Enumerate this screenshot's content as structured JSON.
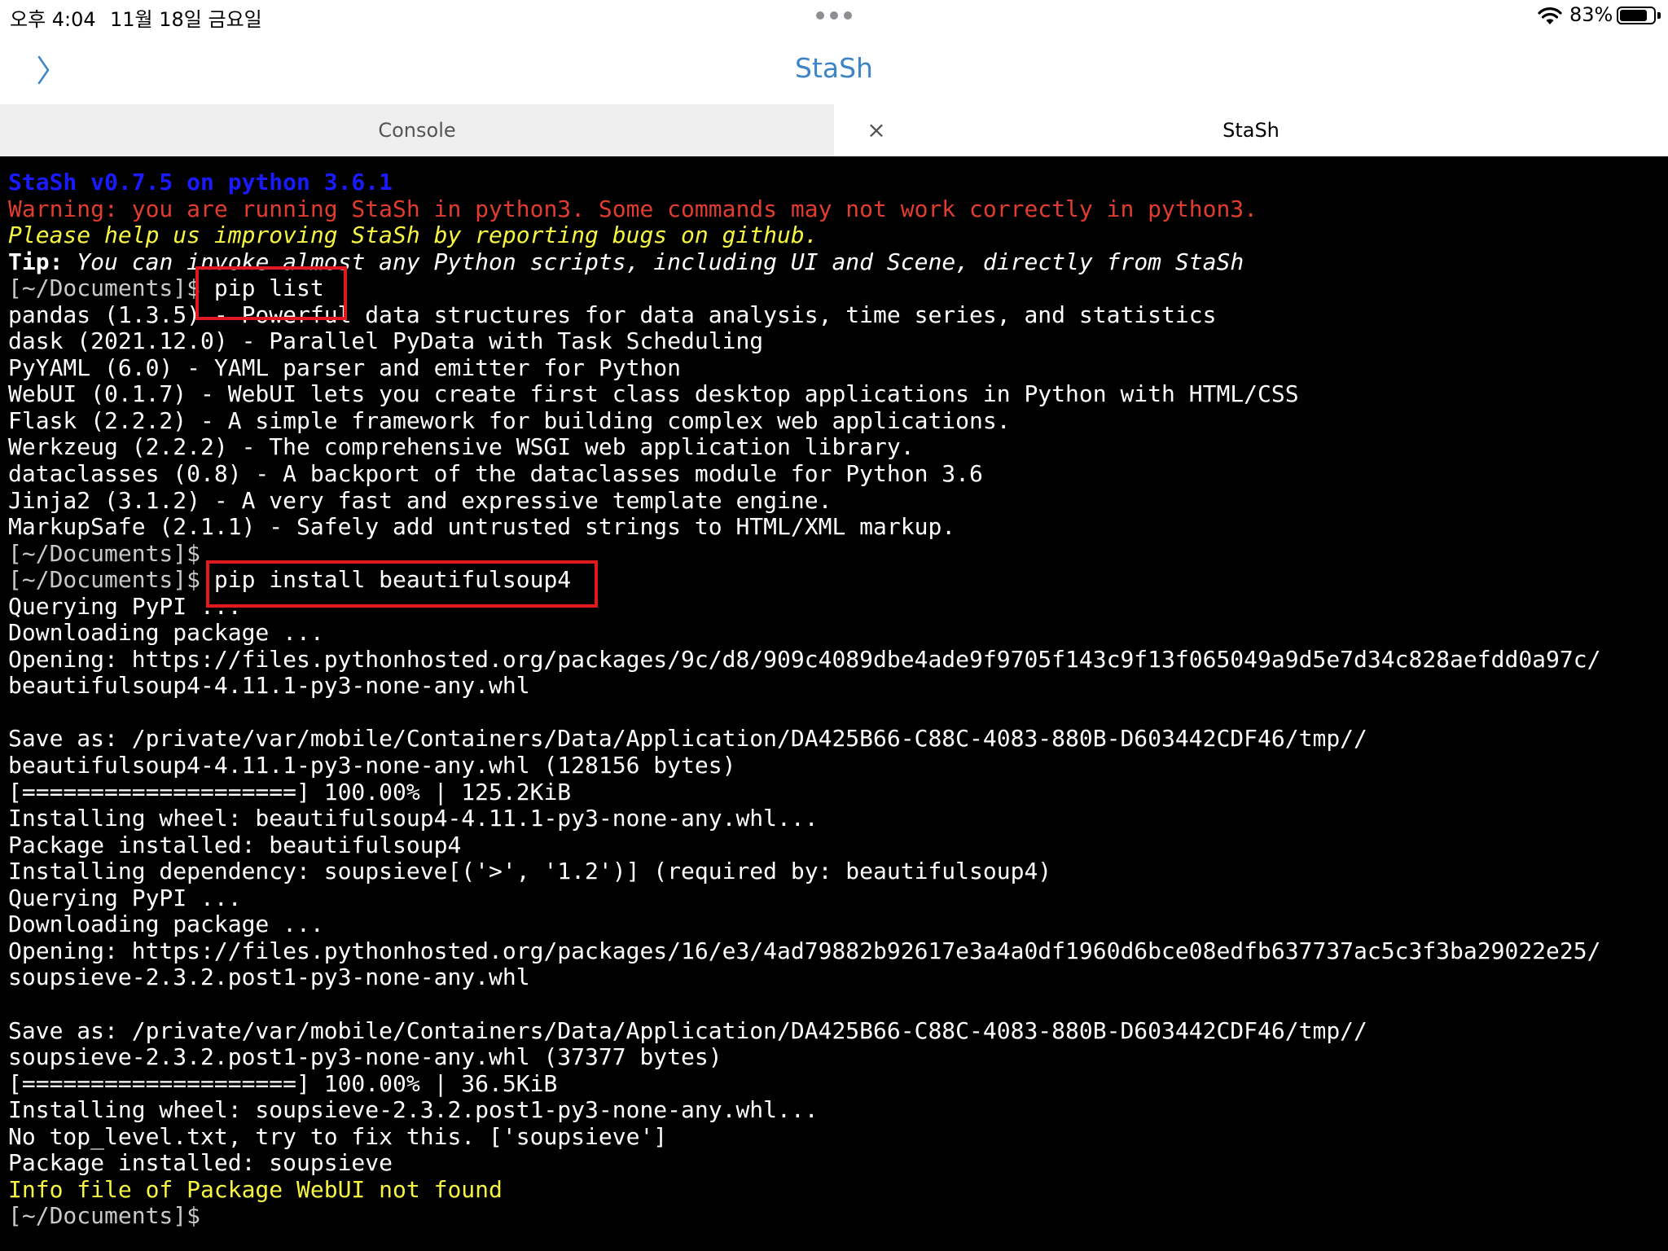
{
  "status": {
    "time": "오후 4:04",
    "date": "11월 18일 금요일",
    "battery": "83%",
    "battery_level": 0.83
  },
  "nav": {
    "title": "StaSh"
  },
  "tabs": [
    {
      "label": "Console"
    },
    {
      "label": "StaSh",
      "close": "×"
    }
  ],
  "terminal": {
    "header": "StaSh v0.7.5 on python 3.6.1",
    "warning": "Warning: you are running StaSh in python3. Some commands may not work correctly in python3.",
    "please": "Please help us improving StaSh by reporting bugs on github.",
    "tip_label": "Tip:",
    "tip_text": " You can invoke almost any Python scripts, including UI and Scene, directly from StaSh",
    "prompt": "[~/Documents]$",
    "cmd1": " pip list",
    "pip_list": [
      "pandas (1.3.5) - Powerful data structures for data analysis, time series, and statistics",
      "dask (2021.12.0) - Parallel PyData with Task Scheduling",
      "PyYAML (6.0) - YAML parser and emitter for Python",
      "WebUI (0.1.7) - WebUI lets you create first class desktop applications in Python with HTML/CSS",
      "Flask (2.2.2) - A simple framework for building complex web applications.",
      "Werkzeug (2.2.2) - The comprehensive WSGI web application library.",
      "dataclasses (0.8) - A backport of the dataclasses module for Python 3.6",
      "Jinja2 (3.1.2) - A very fast and expressive template engine.",
      "MarkupSafe (2.1.1) - Safely add untrusted strings to HTML/XML markup."
    ],
    "cmd2": " pip install beautifulsoup4",
    "install_output": [
      "Querying PyPI ...",
      "Downloading package ...",
      "Opening: https://files.pythonhosted.org/packages/9c/d8/909c4089dbe4ade9f9705f143c9f13f065049a9d5e7d34c828aefdd0a97c/",
      "beautifulsoup4-4.11.1-py3-none-any.whl",
      "",
      "Save as: /private/var/mobile/Containers/Data/Application/DA425B66-C88C-4083-880B-D603442CDF46/tmp//",
      "beautifulsoup4-4.11.1-py3-none-any.whl (128156 bytes)",
      "[====================] 100.00% | 125.2KiB",
      "Installing wheel: beautifulsoup4-4.11.1-py3-none-any.whl...",
      "Package installed: beautifulsoup4",
      "Installing dependency: soupsieve[('>', '1.2')] (required by: beautifulsoup4)",
      "Querying PyPI ...",
      "Downloading package ...",
      "Opening: https://files.pythonhosted.org/packages/16/e3/4ad79882b92617e3a4a0df1960d6bce08edfb637737ac5c3f3ba29022e25/",
      "soupsieve-2.3.2.post1-py3-none-any.whl",
      "",
      "Save as: /private/var/mobile/Containers/Data/Application/DA425B66-C88C-4083-880B-D603442CDF46/tmp//",
      "soupsieve-2.3.2.post1-py3-none-any.whl (37377 bytes)",
      "[====================] 100.00% | 36.5KiB",
      "Installing wheel: soupsieve-2.3.2.post1-py3-none-any.whl...",
      "No top_level.txt, try to fix this. ['soupsieve']",
      "Package installed: soupsieve"
    ],
    "info_not_found": "Info file of Package WebUI not found"
  }
}
